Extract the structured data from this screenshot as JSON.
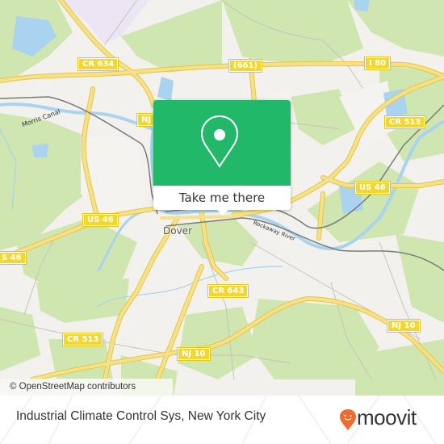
{
  "map": {
    "colors": {
      "land": "#f2f1ed",
      "forest": "#cfe6b0",
      "water": "#a9d3ee",
      "road": "#f3d95b",
      "railway": "#7a7a7a",
      "industrial": "#ece6f4",
      "popup_green": "#21b86a",
      "moovit_orange": "#f26a30"
    },
    "place_labels": {
      "dover": "Dover",
      "morris_canal": "Morris Canal",
      "rockaway_river": "Rockaway River"
    },
    "shields": {
      "cr634": "CR 634",
      "r661": "(661)",
      "i80": "I 80",
      "nj_top": "NJ",
      "cr513_top": "CR 513",
      "us46_left": "US 46",
      "us46_edge": "S 46",
      "us46_right": "US 46",
      "cr643": "CR 643",
      "cr513_bottom": "CR 513",
      "nj10_left": "NJ 10",
      "nj10_right": "NJ 10"
    },
    "attribution": "© OpenStreetMap contributors"
  },
  "popup": {
    "icon": "location-pin-icon",
    "button_label": "Take me there"
  },
  "footer": {
    "title": "Industrial Climate Control Sys, New York City",
    "logo_text": "moovit",
    "logo_icon": "moovit-pin-smile-icon"
  }
}
